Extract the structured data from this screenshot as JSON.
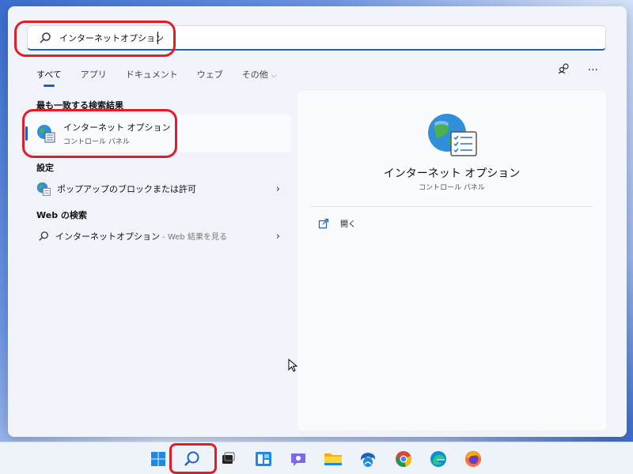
{
  "search": {
    "query": "インターネットオプション",
    "placeholder": ""
  },
  "tabs": [
    {
      "label": "すべて",
      "active": true
    },
    {
      "label": "アプリ"
    },
    {
      "label": "ドキュメント"
    },
    {
      "label": "ウェブ"
    },
    {
      "label": "その他"
    }
  ],
  "top_icons": {
    "account": "account-switch-icon",
    "more": "···"
  },
  "best_match": {
    "heading": "最も一致する検索結果",
    "title": "インターネット オプション",
    "subtitle": "コントロール パネル"
  },
  "settings": {
    "heading": "設定",
    "item": "ポップアップのブロックまたは許可"
  },
  "web": {
    "heading": "Web の検索",
    "item": "インターネットオプション",
    "item_suffix": " - Web 結果を見る"
  },
  "detail": {
    "title": "インターネット オプション",
    "subtitle": "コントロール パネル",
    "action": "開く"
  },
  "taskbar": {
    "items": [
      "windows-start-icon",
      "search-icon",
      "task-view-icon",
      "widgets-icon",
      "teams-chat-icon",
      "file-explorer-icon",
      "app-icon",
      "chrome-icon",
      "edge-icon",
      "firefox-icon"
    ]
  },
  "colors": {
    "accent": "#1a5fc8",
    "highlight_ring": "#e01e28"
  }
}
